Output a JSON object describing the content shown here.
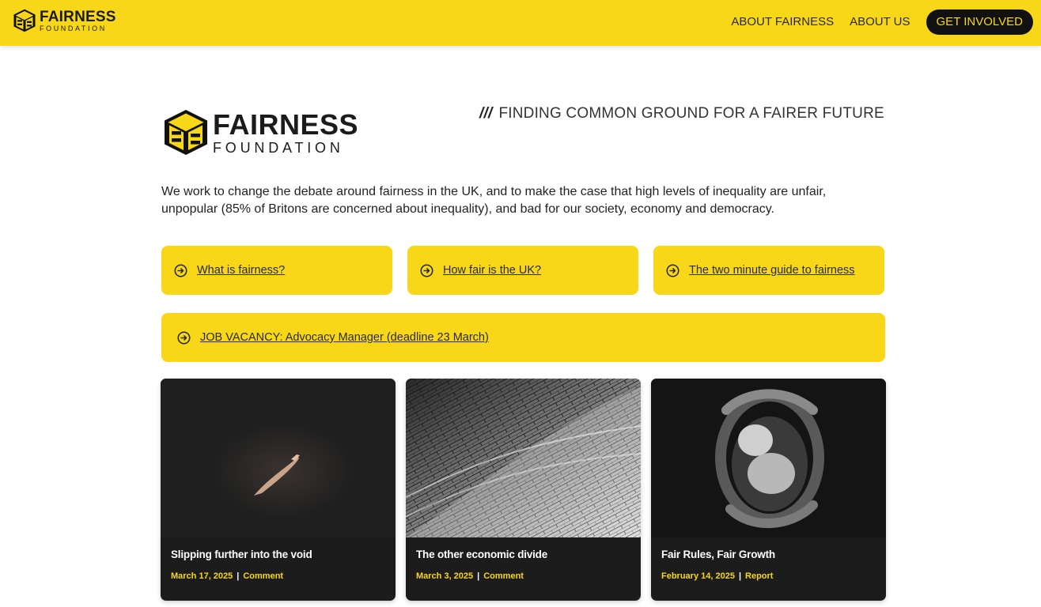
{
  "header": {
    "logo": {
      "name_line1": "FAIRNESS",
      "name_line2": "FOUNDATION"
    },
    "nav": [
      {
        "label": "ABOUT FAIRNESS"
      },
      {
        "label": "ABOUT US"
      }
    ],
    "cta_label": "GET INVOLVED"
  },
  "hero": {
    "logo": {
      "name_line1": "FAIRNESS",
      "name_line2": "FOUNDATION"
    },
    "tagline_prefix": "///",
    "tagline": "FINDING COMMON GROUND FOR A FAIRER FUTURE",
    "intro": "We work to change the debate around fairness in the UK, and to make the case that high levels of inequality are unfair, unpopular (85% of Britons are concerned about inequality), and bad for our society, economy and democracy."
  },
  "quick_links": [
    {
      "label": "What is fairness?",
      "icon": "arrow-circle-right-icon"
    },
    {
      "label": "How fair is the UK?",
      "icon": "arrow-circle-right-icon"
    },
    {
      "label": "The two minute guide to fairness",
      "icon": "arrow-circle-right-icon"
    }
  ],
  "vacancy": {
    "label": "JOB VACANCY: Advocacy Manager (deadline 23 March)",
    "icon": "arrow-circle-right-icon"
  },
  "posts": [
    {
      "title": "Slipping further into the void",
      "date": "March 17, 2025",
      "category": "Comment",
      "image": "hand-reaching-in-dark-image"
    },
    {
      "title": "The other economic divide",
      "date": "March 3, 2025",
      "category": "Comment",
      "image": "curved-brick-wall-image"
    },
    {
      "title": "Fair Rules, Fair Growth",
      "date": "February 14, 2025",
      "category": "Report",
      "image": "hands-holding-baby-image"
    }
  ],
  "colors": {
    "brand_yellow": "#f8d718",
    "dark": "#111111",
    "card_dark": "#1c1c1c"
  }
}
